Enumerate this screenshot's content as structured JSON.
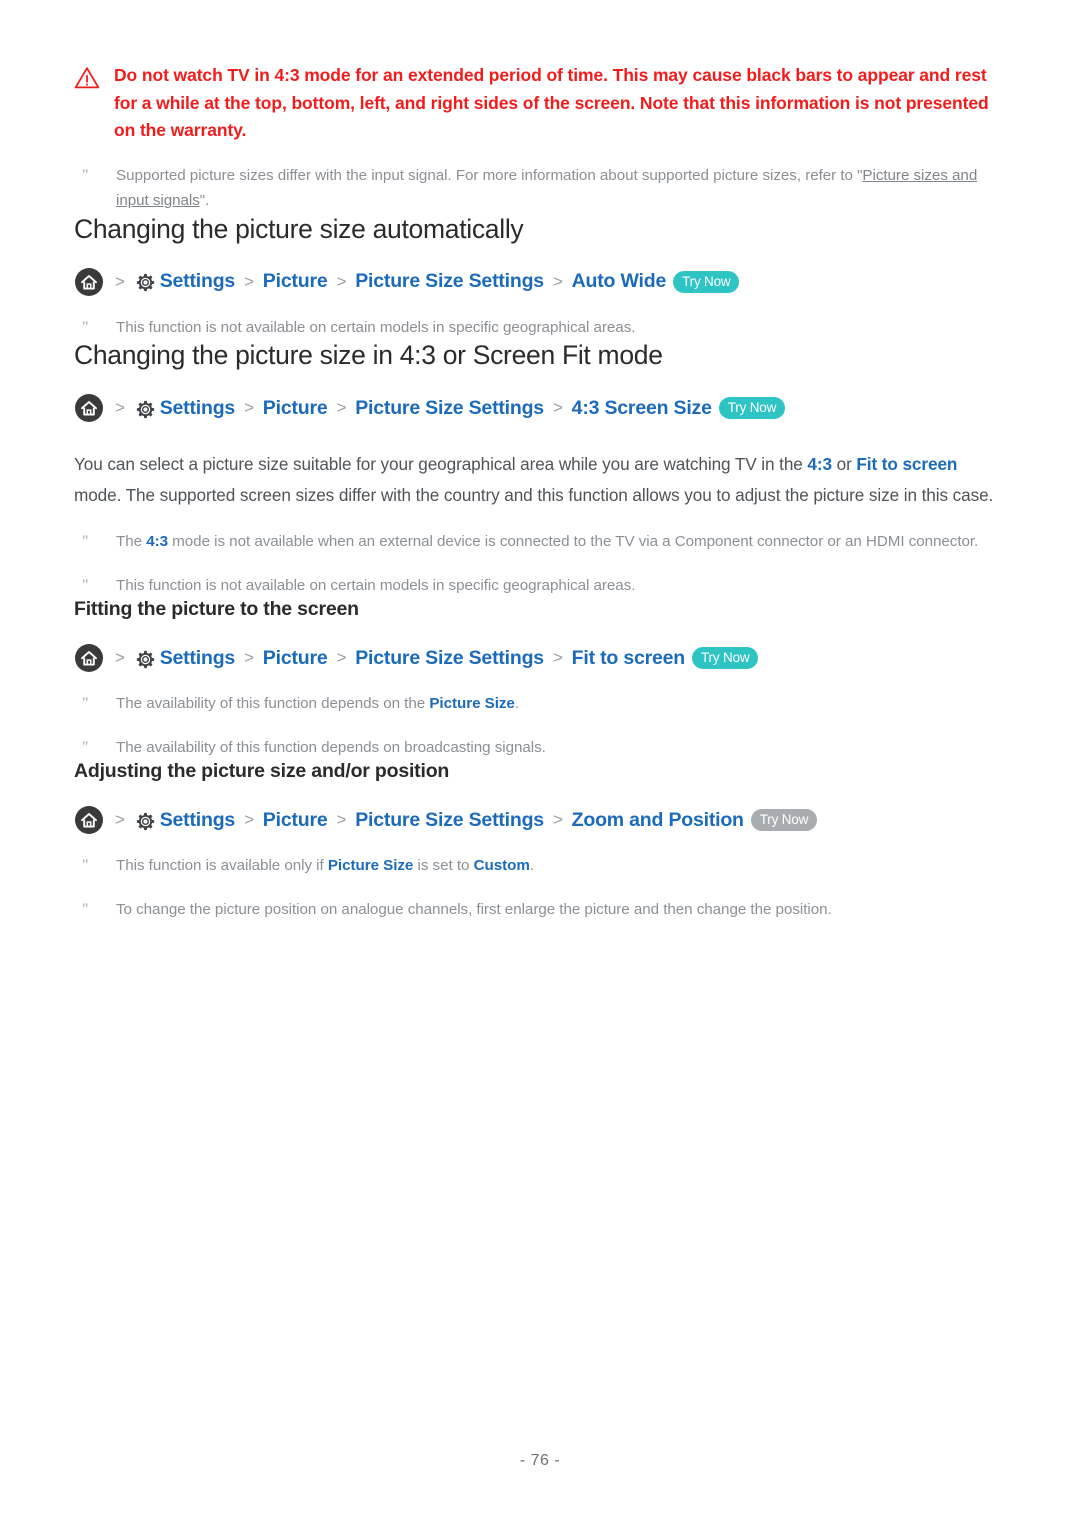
{
  "warning": {
    "icon": "warning-triangle-icon",
    "text": "Do not watch TV in 4:3 mode for an extended period of time. This may cause black bars to appear and rest for a while at the top, bottom, left, and right sides of the screen. Note that this information is not presented on the warranty."
  },
  "notes": {
    "supported_sizes": {
      "mark": "\"",
      "before": "Supported picture sizes differ with the input signal. For more information about supported picture sizes, refer to \"",
      "xref": "Picture sizes and input signals",
      "after": "\"."
    },
    "not_available_models_1": {
      "mark": "\"",
      "text": "This function is not available on certain models in specific geographical areas."
    },
    "component_hdmi": {
      "mark": "\"",
      "before": "The ",
      "kw": "4:3",
      "after": " mode is not available when an external device is connected to the TV via a Component connector or an HDMI connector."
    },
    "not_available_models_2": {
      "mark": "\"",
      "text": "This function is not available on certain models in specific geographical areas."
    },
    "depends_picture_size": {
      "mark": "\"",
      "before": "The availability of this function depends on the ",
      "kw": "Picture Size",
      "after": "."
    },
    "depends_broadcast": {
      "mark": "\"",
      "text": "The availability of this function depends on broadcasting signals."
    },
    "only_if_custom": {
      "mark": "\"",
      "before": "This function is available only if ",
      "kw1": "Picture Size",
      "middle": " is set to ",
      "kw2": "Custom",
      "after": "."
    },
    "analogue_position": {
      "mark": "\"",
      "text": "To change the picture position on analogue channels, first enlarge the picture and then change the position."
    }
  },
  "section_auto": {
    "title": "Changing the picture size automatically",
    "path": {
      "home_icon": "home-icon",
      "gear_icon": "gear-icon",
      "chevron": ">",
      "crumbs": [
        "Settings",
        "Picture",
        "Picture Size Settings",
        "Auto Wide"
      ],
      "badge": "Try Now",
      "badge_state": "active"
    }
  },
  "section_43": {
    "title": "Changing the picture size in 4:3 or Screen Fit mode",
    "path": {
      "home_icon": "home-icon",
      "gear_icon": "gear-icon",
      "chevron": ">",
      "crumbs": [
        "Settings",
        "Picture",
        "Picture Size Settings",
        "4:3 Screen Size"
      ],
      "badge": "Try Now",
      "badge_state": "active"
    },
    "paragraph": {
      "p1": "You can select a picture size suitable for your geographical area while you are watching TV in the ",
      "lk1": "4:3",
      "p2": " or ",
      "lk2": "Fit to screen",
      "p3": " mode. The supported screen sizes differ with the country and this function allows you to adjust the picture size in this case."
    }
  },
  "section_fit": {
    "title": "Fitting the picture to the screen",
    "path": {
      "home_icon": "home-icon",
      "gear_icon": "gear-icon",
      "chevron": ">",
      "crumbs": [
        "Settings",
        "Picture",
        "Picture Size Settings",
        "Fit to screen"
      ],
      "badge": "Try Now",
      "badge_state": "active"
    }
  },
  "section_zoom": {
    "title": "Adjusting the picture size and/or position",
    "path": {
      "home_icon": "home-icon",
      "gear_icon": "gear-icon",
      "chevron": ">",
      "crumbs": [
        "Settings",
        "Picture",
        "Picture Size Settings",
        "Zoom and Position"
      ],
      "badge": "Try Now",
      "badge_state": "disabled"
    }
  },
  "footer": {
    "page_number": "- 76 -"
  },
  "colors": {
    "warning_red": "#f11d1d",
    "link_blue": "#1c6bba",
    "badge_teal": "#2fc4c4",
    "badge_gray": "#a9adb2",
    "body_gray": "#4f5459",
    "note_gray": "#8b9096"
  }
}
